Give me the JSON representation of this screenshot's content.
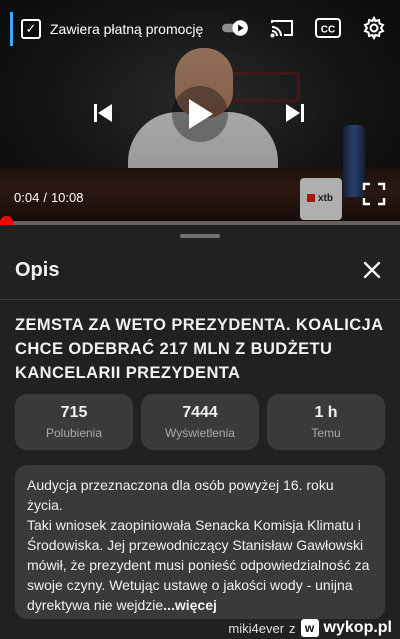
{
  "player": {
    "promo_label": "Zawiera płatną promocję",
    "time_current": "0:04",
    "time_separator": "/",
    "time_total": "10:08",
    "progress": 0.0066,
    "accent_color": "#ff0000",
    "icons": [
      "check-icon",
      "autoplay-toggle-icon",
      "cast-icon",
      "captions-icon",
      "settings-gear-icon",
      "previous-icon",
      "play-icon",
      "next-icon",
      "fullscreen-icon"
    ],
    "captions_label": "CC"
  },
  "sheet": {
    "title": "Opis",
    "video_title": "ZEMSTA ZA WETO PREZYDENTA. KOALICJA CHCE ODEBRAĆ 217 MLN Z BUDŻETU KANCELARII PREZYDENTA",
    "stats": [
      {
        "value": "715",
        "label": "Polubienia"
      },
      {
        "value": "7444",
        "label": "Wyświetlenia"
      },
      {
        "value": "1 h",
        "label": "Temu"
      }
    ],
    "description": "Audycja przeznaczona dla osób powyżej 16. roku życia.\nTaki wniosek zaopiniowała Senacka Komisja Klimatu i Środowiska. Jej przewodniczący Stanisław Gawłowski mówił, że prezydent musi ponieść odpowiedzialność za swoje czyny. Wetując ustawę o jakości wody - unijna dyrektywa nie wejdzie",
    "more_label": "...więcej"
  },
  "watermark": {
    "user": "miki4ever",
    "letter": "z",
    "badge": "w",
    "brand": "wykop.pl"
  }
}
